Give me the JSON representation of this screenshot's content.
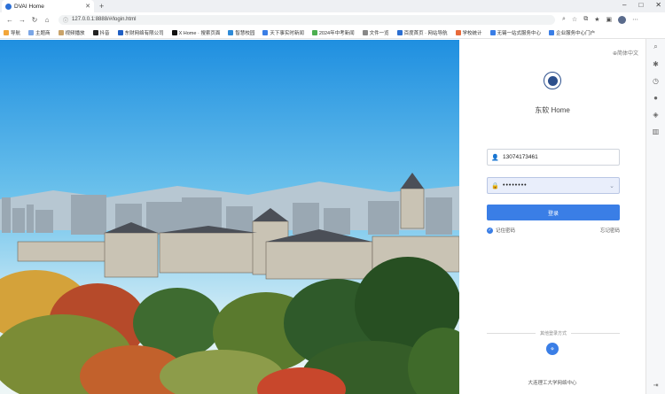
{
  "browser": {
    "tab_title": "DVAI Home",
    "url": "127.0.0.1:8888/#/login.html",
    "bookmarks": [
      {
        "label": "导航",
        "color": "#f2a63a"
      },
      {
        "label": "主题商",
        "color": "#7aa6e6"
      },
      {
        "label": "视频播放",
        "color": "#c9a36a"
      },
      {
        "label": "抖音",
        "color": "#222222"
      },
      {
        "label": "东财网络有限公司",
        "color": "#1f5fc4"
      },
      {
        "label": "X Home · 搜索页面",
        "color": "#111111"
      },
      {
        "label": "智慧校园",
        "color": "#2e8bd8"
      },
      {
        "label": "天下事实时新闻",
        "color": "#3a7ee6"
      },
      {
        "label": "2024年中考新闻",
        "color": "#4caf50"
      },
      {
        "label": "文件一览",
        "color": "#888888"
      },
      {
        "label": "百度首页 · 网站导航",
        "color": "#2c6fd1"
      },
      {
        "label": "学校统计",
        "color": "#e86a3a"
      },
      {
        "label": "无锡一站式服务中心",
        "color": "#3a7ee6"
      },
      {
        "label": "企业服务中心门户",
        "color": "#3a7ee6"
      }
    ]
  },
  "login": {
    "lang_label": "⊕简体中文",
    "title": "东软 Home",
    "username": "13074173461",
    "password_mask": "••••••••",
    "login_button": "登录",
    "remember_label": "记住密码",
    "forgot_label": "忘记密码",
    "other_login_label": "其他登录方式",
    "footer": "大连理工大学网络中心"
  },
  "colors": {
    "accent": "#3a7ee6",
    "logo": "#2c4f8c"
  }
}
